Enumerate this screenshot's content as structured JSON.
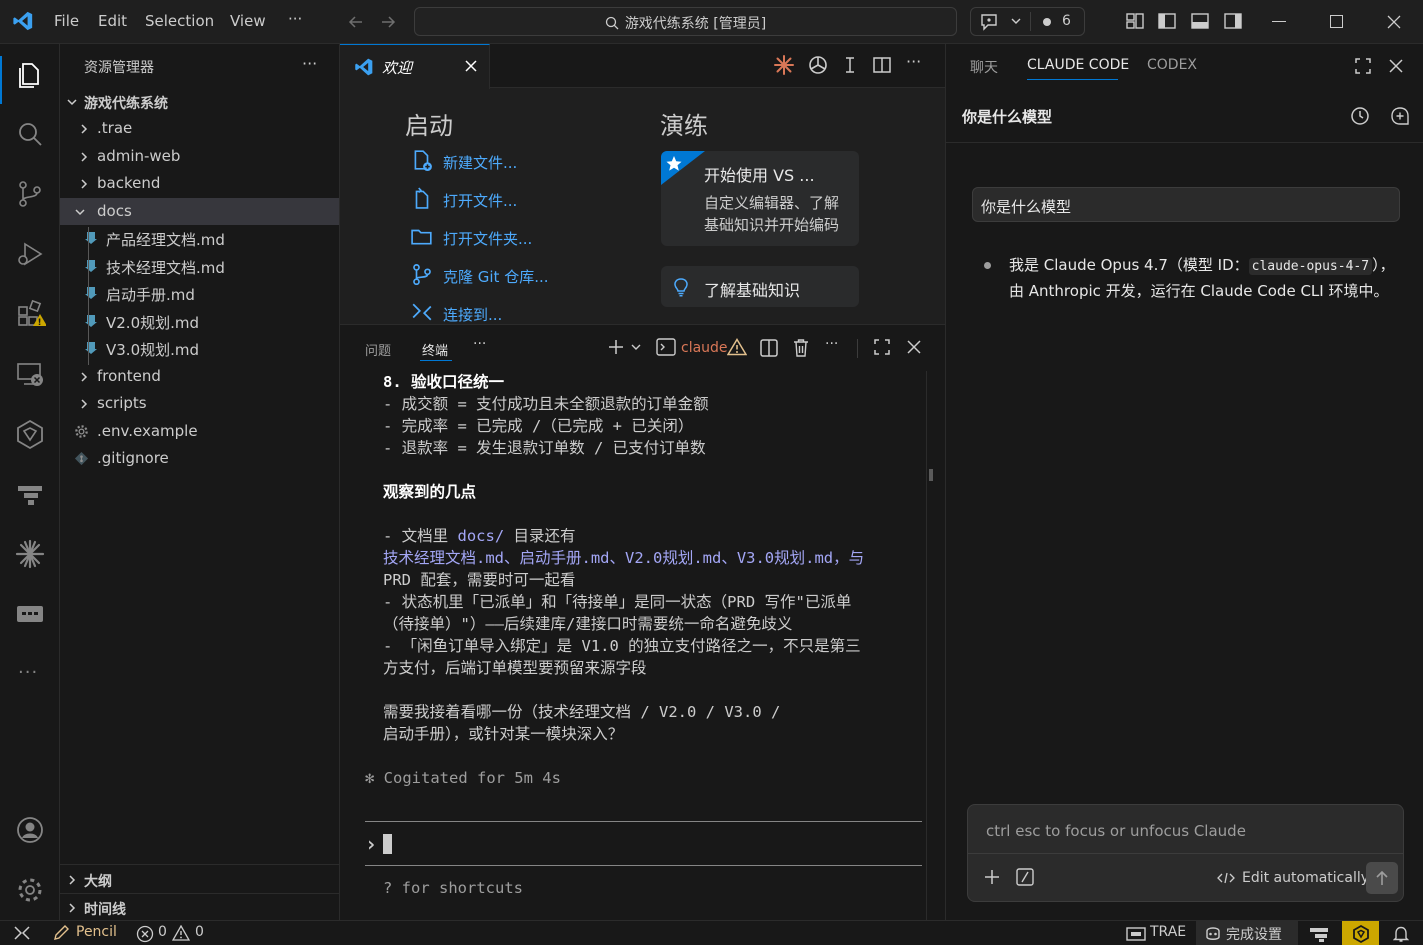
{
  "titlebar": {
    "menus": [
      "File",
      "Edit",
      "Selection",
      "View",
      "···"
    ],
    "search_text": "游戏代练系统 [管理员]",
    "notification_count": "6"
  },
  "sidebar": {
    "title": "资源管理器",
    "more": "···",
    "root": "游戏代练系统",
    "items": [
      {
        "label": ".trae",
        "type": "folder"
      },
      {
        "label": "admin-web",
        "type": "folder"
      },
      {
        "label": "backend",
        "type": "folder"
      },
      {
        "label": "docs",
        "type": "folder-open"
      },
      {
        "label": "产品经理文档.md",
        "type": "md"
      },
      {
        "label": "技术经理文档.md",
        "type": "md"
      },
      {
        "label": "启动手册.md",
        "type": "md"
      },
      {
        "label": "V2.0规划.md",
        "type": "md"
      },
      {
        "label": "V3.0规划.md",
        "type": "md"
      },
      {
        "label": "frontend",
        "type": "folder"
      },
      {
        "label": "scripts",
        "type": "folder"
      },
      {
        "label": ".env.example",
        "type": "gear"
      },
      {
        "label": ".gitignore",
        "type": "git"
      }
    ],
    "outline": "大纲",
    "timeline": "时间线"
  },
  "editor": {
    "tab_label": "欢迎",
    "start_heading": "启动",
    "start_links": [
      "新建文件...",
      "打开文件...",
      "打开文件夹...",
      "克隆 Git 仓库...",
      "连接到..."
    ],
    "walk_heading": "演练",
    "card1_title": "开始使用 VS ...",
    "card1_desc1": "自定义编辑器、了解",
    "card1_desc2": "基础知识并开始编码",
    "card2_title": "了解基础知识"
  },
  "panel": {
    "tabs": [
      "问题",
      "终端"
    ],
    "more": "···",
    "terminal_name": "claude",
    "lines": [
      {
        "t": "8. 验收口径统一",
        "bold": true
      },
      {
        "t": "- 成交额 = 支付成功且未全额退款的订单金额"
      },
      {
        "t": "- 完成率 = 已完成 /（已完成 + 已关闭）"
      },
      {
        "t": "- 退款率 = 发生退款订单数 / 已支付订单数"
      },
      {
        "t": ""
      },
      {
        "t": "观察到的几点",
        "bold": true
      },
      {
        "t": ""
      },
      {
        "t": "- 文档里 docs/ 目录还有"
      },
      {
        "t": "技术经理文档.md、启动手册.md、V2.0规划.md、V3.0规划.md，与"
      },
      {
        "t": "PRD 配套，需要时可一起看"
      },
      {
        "t": "- 状态机里「已派单」和「待接单」是同一状态（PRD 写作\"已派单"
      },
      {
        "t": "（待接单）\"）——后续建库/建接口时需要统一命名避免歧义"
      },
      {
        "t": "- 「闲鱼订单导入绑定」是 V1.0 的独立支付路径之一，不只是第三"
      },
      {
        "t": "方支付，后端订单模型要预留来源字段"
      },
      {
        "t": ""
      },
      {
        "t": "需要我接着看哪一份（技术经理文档 / V2.0 / V3.0 /"
      },
      {
        "t": "启动手册），或针对某一模块深入？"
      }
    ],
    "docs_ref": "docs/",
    "cogitated": "✻ Cogitated for 5m 4s",
    "prompt": "›",
    "shortcuts": "? for shortcuts"
  },
  "chat": {
    "tabs": [
      "聊天",
      "CLAUDE CODE",
      "CODEX"
    ],
    "session_title": "你是什么模型",
    "user_message": "你是什么模型",
    "reply_a": "我是 Claude Opus 4.7（模型 ID：",
    "reply_code": "claude-opus-4-7",
    "reply_b": "），由 Anthropic 开发，运行在 Claude Code CLI 环境中。",
    "input_placeholder": "ctrl esc to focus or unfocus Claude",
    "mode_label": "Edit automatically"
  },
  "statusbar": {
    "pencil": "Pencil",
    "errors": "0",
    "warnings": "0",
    "trae": "TRAE",
    "setup": "完成设置"
  },
  "colors": {
    "accent": "#0078d4",
    "link": "#4daafc",
    "warning": "#e2c08d",
    "claude": "#d97757"
  }
}
